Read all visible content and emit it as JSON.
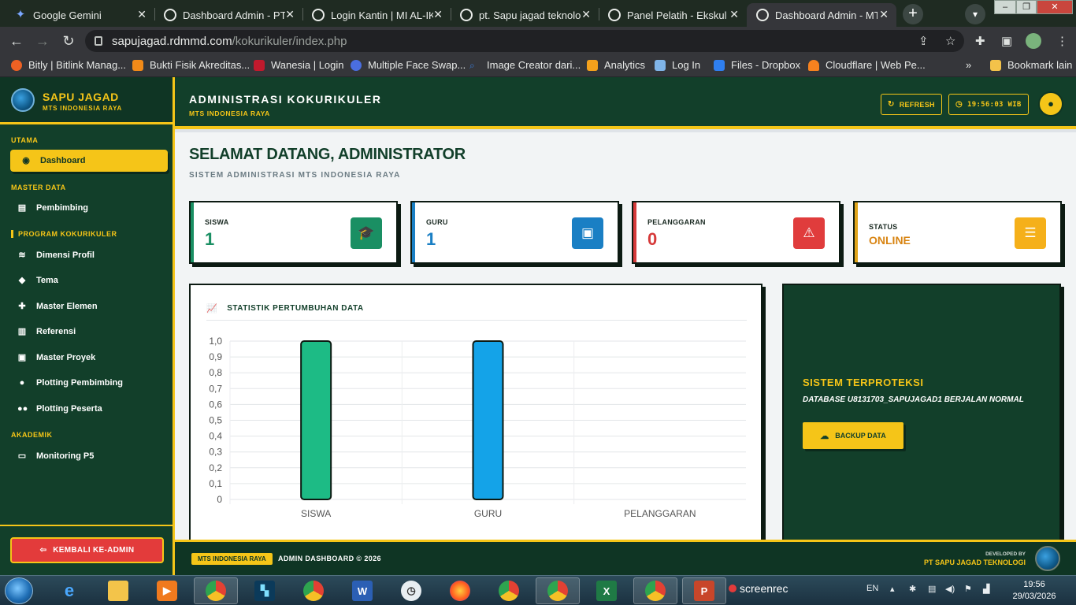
{
  "browser": {
    "tabs": [
      {
        "label": "Google Gemini",
        "active": false
      },
      {
        "label": "Dashboard Admin - PT.",
        "active": false
      },
      {
        "label": "Login Kantin | MI AL-IK",
        "active": false
      },
      {
        "label": "pt. Sapu jagad teknolog",
        "active": false
      },
      {
        "label": "Panel Pelatih - Ekskul",
        "active": false
      },
      {
        "label": "Dashboard Admin - MT",
        "active": true
      }
    ],
    "url_host": "sapujagad.rdmmd.com",
    "url_path": "/kokurikuler/index.php",
    "bookmarks": [
      "Bitly | Bitlink Manag...",
      "Bukti Fisik Akreditas...",
      "Wanesia | Login",
      "Multiple Face Swap...",
      "Image Creator dari...",
      "Analytics",
      "Log In",
      "Files - Dropbox",
      "Cloudflare | Web Pe..."
    ],
    "bookmarks_overflow": "»",
    "bookmark_folder": "Bookmark lain"
  },
  "brand": {
    "name": "SAPU JAGAD",
    "sub": "MTS INDONESIA RAYA"
  },
  "sidebar": {
    "sec_utama": "UTAMA",
    "dashboard": "Dashboard",
    "sec_master": "MASTER DATA",
    "pembimbing": "Pembimbing",
    "sec_program": "PROGRAM KOKURIKULER",
    "dimensi": "Dimensi Profil",
    "tema": "Tema",
    "elemen": "Master Elemen",
    "referensi": "Referensi",
    "proyek": "Master Proyek",
    "plotting_pembimbing": "Plotting Pembimbing",
    "plotting_peserta": "Plotting Peserta",
    "sec_akademik": "AKADEMIK",
    "monitoring": "Monitoring P5",
    "back": "KEMBALI KE-ADMIN"
  },
  "topbar": {
    "title": "ADMINISTRASI KOKURIKULER",
    "subtitle": "MTS INDONESIA RAYA",
    "refresh": "REFRESH",
    "clock": "19:56:03 WIB"
  },
  "main": {
    "welcome": "SELAMAT DATANG, ADMINISTRATOR",
    "welcome_sub": "SISTEM ADMINISTRASI MTS INDONESIA RAYA"
  },
  "cards": {
    "siswa": {
      "label": "SISWA",
      "value": "1",
      "color": "#1a8f63"
    },
    "guru": {
      "label": "GURU",
      "value": "1",
      "color": "#1a7fc4"
    },
    "pelanggaran": {
      "label": "PELANGGARAN",
      "value": "0",
      "color": "#d63a3a"
    },
    "status": {
      "label": "STATUS",
      "value": "ONLINE",
      "color": "#e0a419"
    }
  },
  "chart_data": {
    "type": "bar",
    "title": "STATISTIK PERTUMBUHAN DATA",
    "categories": [
      "SISWA",
      "GURU",
      "PELANGGARAN"
    ],
    "values": [
      1,
      1,
      0
    ],
    "colors": [
      "#1dbb85",
      "#14a3e8",
      "#e84b4b"
    ],
    "ylim": [
      0,
      1
    ],
    "yticks": [
      "1,0",
      "0,9",
      "0,8",
      "0,7",
      "0,6",
      "0,5",
      "0,4",
      "0,3",
      "0,2",
      "0,1",
      "0"
    ],
    "grid": true,
    "legend": "none"
  },
  "system": {
    "title": "SISTEM TERPROTEKSI",
    "desc": "DATABASE U8131703_SAPUJAGAD1 BERJALAN NORMAL",
    "backup": "BACKUP DATA"
  },
  "footer": {
    "badge": "MTS INDONESIA RAYA",
    "copy": "ADMIN DASHBOARD © 2026",
    "dev_label": "DEVELOPED BY",
    "dev_name": "PT SAPU JAGAD TEKNOLOGI"
  },
  "taskbar": {
    "screenrec": "screenrec",
    "lang": "EN",
    "time": "19:56",
    "date": "29/03/2026"
  }
}
